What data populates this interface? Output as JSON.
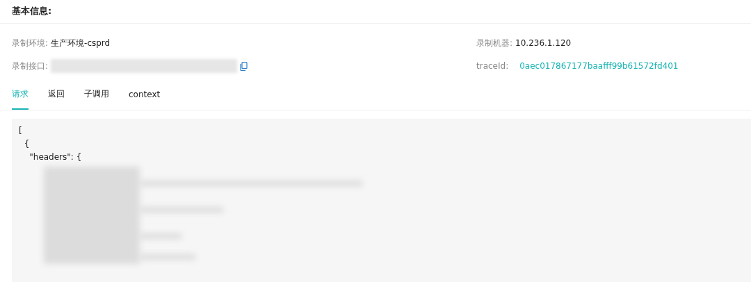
{
  "section_title": "基本信息:",
  "fields": [
    {
      "label": "录制环境:",
      "kind": "text",
      "value": "生产环境-csprd"
    },
    {
      "label": "录制机器:",
      "kind": "text",
      "value": "10.236.1.120"
    },
    {
      "label": "录制接口:",
      "kind": "redacted"
    },
    {
      "label": "traceId:",
      "kind": "link",
      "value": "0aec017867177baafff99b61572fd401"
    }
  ],
  "tabs": [
    {
      "label": "请求",
      "selected": true
    },
    {
      "label": "返回",
      "selected": false
    },
    {
      "label": "子调用",
      "selected": false
    },
    {
      "label": "context",
      "selected": false
    }
  ],
  "code_lines": [
    "[",
    "  {",
    "    \"headers\": {"
  ]
}
